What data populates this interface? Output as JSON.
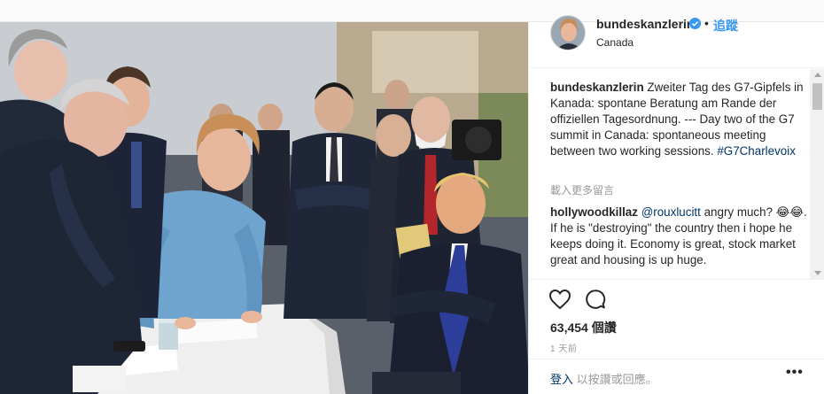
{
  "post": {
    "username": "bundeskanzlerin",
    "follow_label": "追蹤",
    "dot": "•",
    "location": "Canada",
    "photo_icon": "g7-summit-photo"
  },
  "comments": [
    {
      "username": "bundeskanzlerin",
      "text": "Zweiter Tag des G7-Gipfels in Kanada: spontane Beratung am Rande der offiziellen Tagesordnung. --- Day two of the G7 summit in Canada: spontaneous meeting between two working sessions.",
      "hashtag": "#G7Charlevoix"
    },
    {
      "username": "hollywoodkillaz",
      "mention": "@rouxlucitt",
      "text": "angry much? 😂😂. If he is \"destroying\" the country then i hope he keeps doing it. Economy is great, stock market great and housing is up huge."
    }
  ],
  "load_more_label": "載入更多留言",
  "likes": "63,454 個讚",
  "time_ago": "1 天前",
  "login": {
    "link_label": "登入",
    "text": "以按讚或回應。",
    "more_label": "•••"
  },
  "colors": {
    "accent": "#3897f0",
    "link": "#003569",
    "muted": "#999999",
    "text": "#262626"
  }
}
